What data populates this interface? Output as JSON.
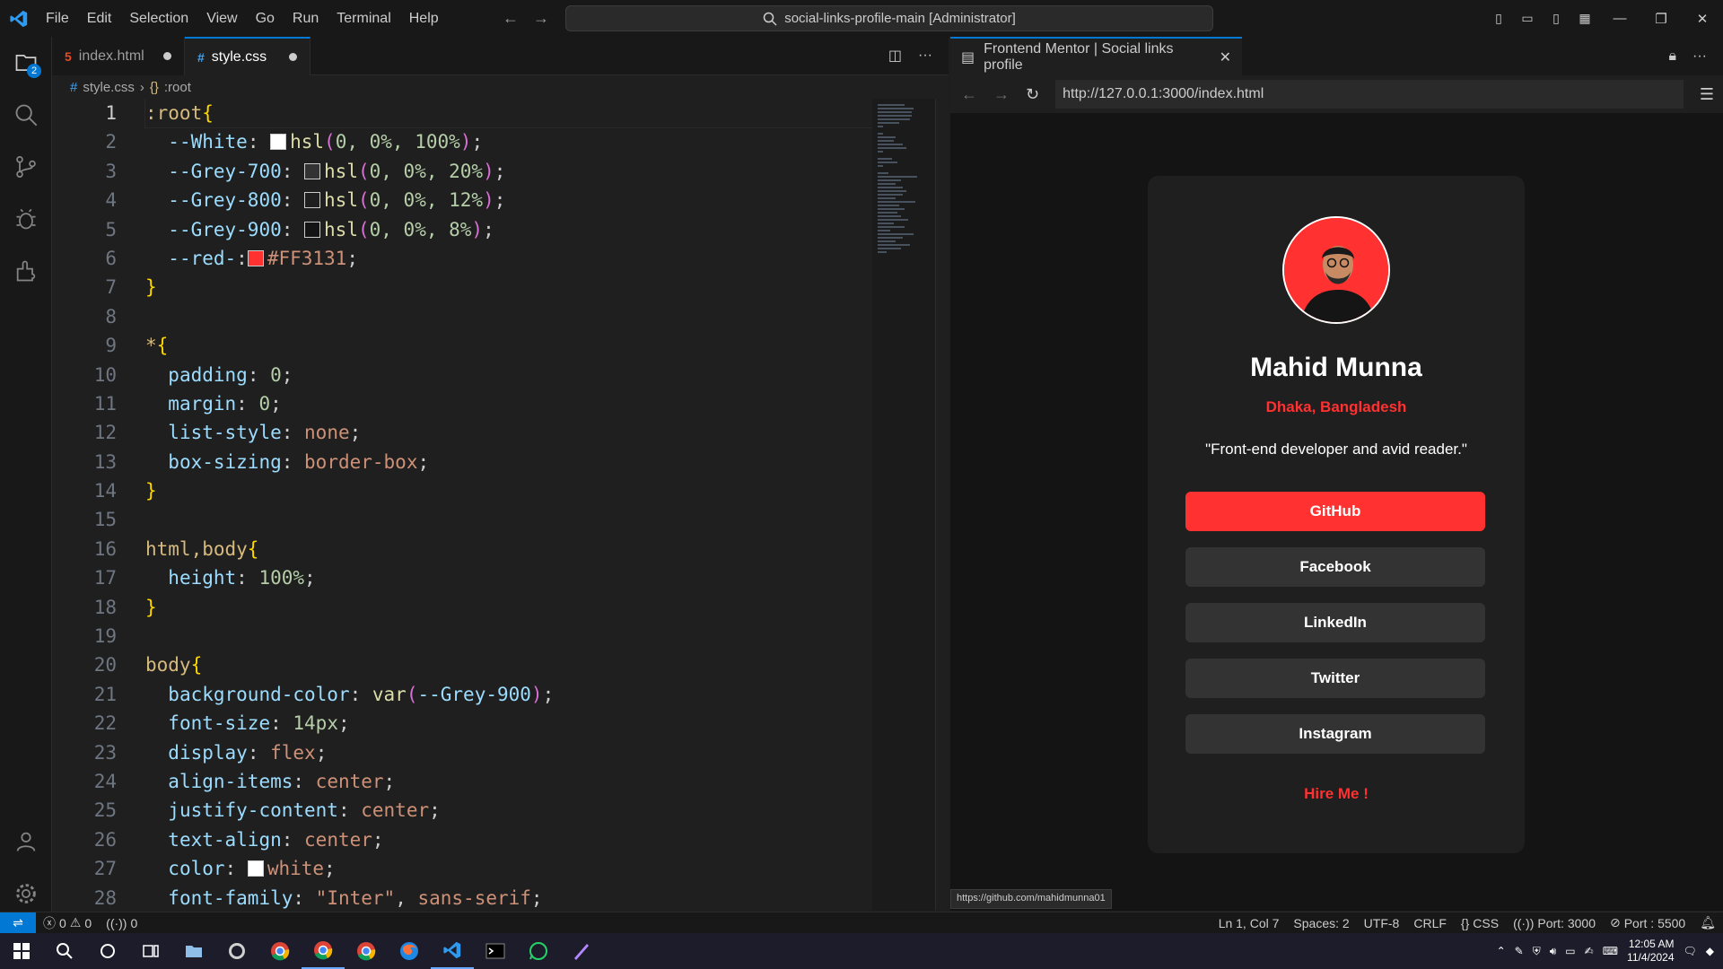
{
  "titlebar": {
    "menu": [
      "File",
      "Edit",
      "Selection",
      "View",
      "Go",
      "Run",
      "Terminal",
      "Help"
    ],
    "search": "social-links-profile-main [Administrator]"
  },
  "activity": {
    "explorer_badge": "2"
  },
  "editor": {
    "tabs": [
      {
        "label": "index.html",
        "modified": true
      },
      {
        "label": "style.css",
        "modified": true,
        "active": true
      }
    ],
    "breadcrumb": {
      "file": "style.css",
      "symbol": ":root"
    },
    "line_numbers": [
      "1",
      "2",
      "3",
      "4",
      "5",
      "6",
      "7",
      "8",
      "9",
      "10",
      "11",
      "12",
      "13",
      "14",
      "15",
      "16",
      "17",
      "18",
      "19",
      "20",
      "21",
      "22",
      "23",
      "24",
      "25",
      "26",
      "27",
      "28"
    ]
  },
  "code": {
    "l1_sel": ":root",
    "l2_prop": "--White",
    "l2_fn": "hsl",
    "l2_args": "0, 0%, 100%",
    "l3_prop": "--Grey-700",
    "l3_args": "0, 0%, 20%",
    "l4_prop": "--Grey-800",
    "l4_args": "0, 0%, 12%",
    "l5_prop": "--Grey-900",
    "l5_args": "0, 0%, 8%",
    "l6_prop": "--red-",
    "l6_val": "#FF3131",
    "l9_sel": "*",
    "l10_prop": "padding",
    "l10_val": "0",
    "l11_prop": "margin",
    "l11_val": "0",
    "l12_prop": "list-style",
    "l12_val": "none",
    "l13_prop": "box-sizing",
    "l13_val": "border-box",
    "l16_sel": "html,body",
    "l17_prop": "height",
    "l17_val": "100%",
    "l20_sel": "body",
    "l21_prop": "background-color",
    "l21_fn": "var",
    "l21_arg": "--Grey-900",
    "l22_prop": "font-size",
    "l22_val": "14px",
    "l23_prop": "display",
    "l23_val": "flex",
    "l24_prop": "align-items",
    "l24_val": "center",
    "l25_prop": "justify-content",
    "l25_val": "center",
    "l26_prop": "text-align",
    "l26_val": "center",
    "l27_prop": "color",
    "l27_val": "white",
    "l28_prop": "font-family",
    "l28_val": "\"Inter\"",
    "l28_val2": "sans-serif"
  },
  "browser": {
    "tab_title": "Frontend Mentor | Social links profile",
    "url": "http://127.0.0.1:3000/index.html",
    "hover_url": "https://github.com/mahidmunna01"
  },
  "profile": {
    "name": "Mahid Munna",
    "location": "Dhaka, Bangladesh",
    "bio": "\"Front-end developer and avid reader.\"",
    "links": [
      "GitHub",
      "Facebook",
      "LinkedIn",
      "Twitter",
      "Instagram"
    ],
    "cta": "Hire Me !"
  },
  "statusbar": {
    "errors": "0",
    "warnings": "0",
    "ports": "0",
    "cursor": "Ln 1, Col 7",
    "spaces": "Spaces: 2",
    "encoding": "UTF-8",
    "eol": "CRLF",
    "language": "CSS",
    "port": "Port: 3000",
    "port2": "Port : 5500"
  },
  "taskbar": {
    "time": "12:05 AM",
    "date": "11/4/2024"
  },
  "colors": {
    "accent": "#0078d4",
    "red": "#FF3131",
    "grey900": "#141414"
  }
}
